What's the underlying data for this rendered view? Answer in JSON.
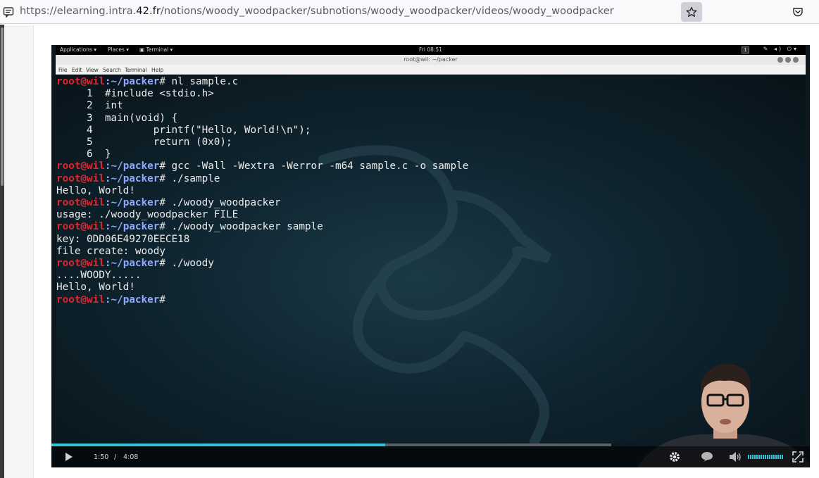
{
  "browser": {
    "url_prefix": "https://elearning.intra.",
    "url_host": "42.fr",
    "url_path": "/notions/woody_woodpacker/subnotions/woody_woodpacker/videos/woody_woodpacker",
    "icons": [
      "page-info-icon",
      "bookmark-star-icon",
      "pocket-icon"
    ]
  },
  "video": {
    "gnome_panel": {
      "applications": "Applications ▾",
      "places": "Places ▾",
      "terminal": "▣ Terminal ▾",
      "clock": "Fri 08:51",
      "workspace": "1"
    },
    "terminal_window": {
      "title": "root@wil: ~/packer",
      "menu": [
        "File",
        "Edit",
        "View",
        "Search",
        "Terminal",
        "Help"
      ]
    },
    "terminal_lines": [
      {
        "user": "root@wil",
        "path": ":~/packer",
        "cmd": "# nl sample.c"
      },
      {
        "out": "     1  #include <stdio.h>"
      },
      {
        "out": ""
      },
      {
        "out": "     2  int"
      },
      {
        "out": "     3  main(void) {"
      },
      {
        "out": "     4          printf(\"Hello, World!\\n\");"
      },
      {
        "out": "     5          return (0x0);"
      },
      {
        "out": "     6  }"
      },
      {
        "user": "root@wil",
        "path": ":~/packer",
        "cmd": "# gcc -Wall -Wextra -Werror -m64 sample.c -o sample"
      },
      {
        "user": "root@wil",
        "path": ":~/packer",
        "cmd": "# ./sample"
      },
      {
        "out": "Hello, World!"
      },
      {
        "user": "root@wil",
        "path": ":~/packer",
        "cmd": "# ./woody_woodpacker"
      },
      {
        "out": "usage: ./woody_woodpacker FILE"
      },
      {
        "out": ""
      },
      {
        "user": "root@wil",
        "path": ":~/packer",
        "cmd": "# ./woody_woodpacker sample"
      },
      {
        "out": "key: 0DD06E49270EECE18"
      },
      {
        "out": "file create: woody"
      },
      {
        "user": "root@wil",
        "path": ":~/packer",
        "cmd": "# ./woody"
      },
      {
        "out": "....WOODY....."
      },
      {
        "out": "Hello, World!"
      },
      {
        "user": "root@wil",
        "path": ":~/packer",
        "cmd": "#"
      }
    ],
    "player": {
      "current_time": "1:50",
      "separator": "/",
      "duration": "4:08",
      "progress_fraction": 0.44,
      "volume_fraction": 0.85,
      "accent_color": "#33c4d4",
      "icons": [
        "play-icon",
        "settings-gear-icon",
        "subtitles-icon",
        "volume-icon",
        "fullscreen-icon"
      ]
    }
  }
}
